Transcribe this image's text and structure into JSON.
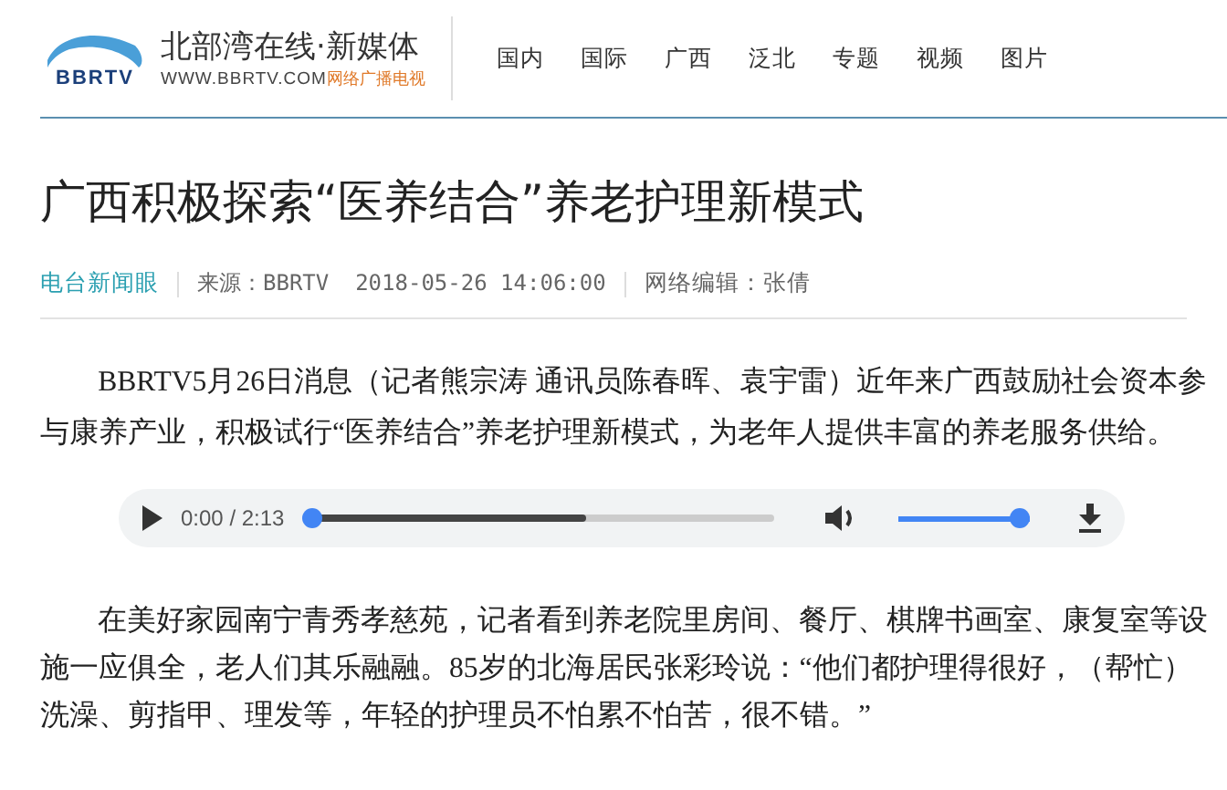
{
  "header": {
    "logo": {
      "brand": "BBRTV",
      "name": "北部湾在线·新媒体",
      "url": "WWW.BBRTV.COM",
      "tagline": "网络广播电视"
    },
    "nav": [
      {
        "label": "国内"
      },
      {
        "label": "国际"
      },
      {
        "label": "广西"
      },
      {
        "label": "泛北"
      },
      {
        "label": "专题"
      },
      {
        "label": "视频"
      },
      {
        "label": "图片"
      }
    ]
  },
  "article": {
    "title": "广西积极探索“医养结合”养老护理新模式",
    "meta": {
      "column": "电台新闻眼",
      "source": "来源：BBRTV  2018-05-26 14:06:00",
      "editor": "网络编辑：张倩"
    },
    "paragraphs": [
      "BBRTV5月26日消息（记者熊宗涛 通讯员陈春晖、袁宇雷）近年来广西鼓励社会资本参与康养产业，积极试行“医养结合”养老护理新模式，为老年人提供丰富的养老服务供给。"
    ],
    "audio": {
      "time": "0:00 / 2:13",
      "progress": {
        "level": 0
      },
      "volume": {
        "level": 1
      }
    },
    "paragraphs_after": [
      "在美好家园南宁青秀孝慈苑，记者看到养老院里房间、餐厅、棋牌书画室、康复室等设施一应俱全，老人们其乐融融。85岁的北海居民张彩玲说：“他们都护理得很好，（帮忙）洗澡、剪指甲、理发等，年轻的护理员不怕累不怕苦，很不错。”"
    ]
  }
}
